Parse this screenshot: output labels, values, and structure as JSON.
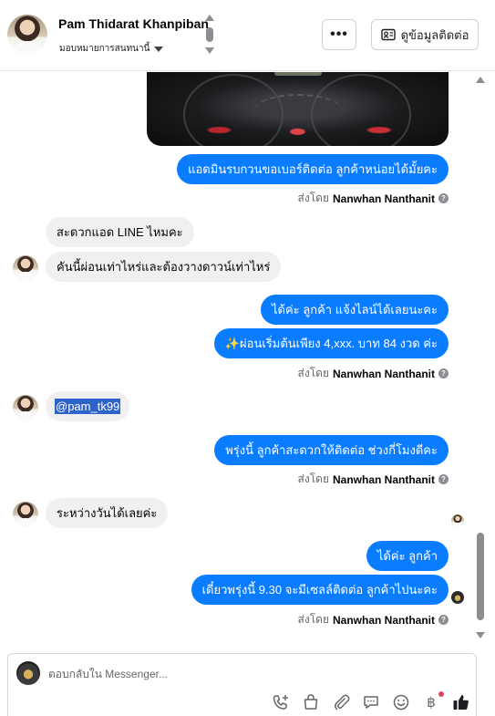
{
  "header": {
    "contact_name": "Pam Thidarat Khanpiban",
    "assign_label": "มอบหมายการสนทนานี้",
    "more_label": "•••",
    "contact_info_label": "ดูข้อมูลติดต่อ"
  },
  "messages": [
    {
      "from": "page",
      "text": "แอดมินรบกวนขอเบอร์ติดต่อ ลูกค้าหน่อยได้มั้ยคะ"
    },
    {
      "from": "customer",
      "text": "สะดวกแอด LINE ไหมคะ"
    },
    {
      "from": "customer",
      "text": "คันนี้ผ่อนเท่าไหร่และต้องวางดาวน์เท่าไหร่"
    },
    {
      "from": "page",
      "text": "ได้ค่ะ  ลูกค้า แจ้งไลน์ได้เลยนะคะ"
    },
    {
      "from": "page",
      "text": "✨ผ่อนเริ่มต้นเพียง 4,xxx. บาท 84 งวด ค่ะ"
    },
    {
      "from": "customer",
      "text": "@pam_tk99"
    },
    {
      "from": "page",
      "text": "พรุ่งนี้ ลูกค้าสะดวกให้ติดต่อ ช่วงกี่โมงดีคะ"
    },
    {
      "from": "customer",
      "text": "ระหว่างวันได้เลยค่ะ"
    },
    {
      "from": "page",
      "text": "ได้ค่ะ  ลูกค้า"
    },
    {
      "from": "page",
      "text": "เดี๋ยวพรุ่งนี้ 9.30 จะมีเซลล์ติดต่อ ลูกค้าไปนะคะ"
    }
  ],
  "sent_by": {
    "prefix": "ส่งโดย",
    "agent": "Nanwhan Nanthanit"
  },
  "composer": {
    "placeholder": "ตอบกลับใน Messenger...",
    "value": "",
    "currency_symbol": "฿"
  },
  "icons": {
    "more": "more-dots-icon",
    "contact": "contact-card-icon",
    "call": "phone-add-icon",
    "shop": "shopping-bag-icon",
    "attach": "paperclip-icon",
    "saved_reply": "chat-bubble-icon",
    "emoji": "smile-icon",
    "payment": "baht-icon",
    "like": "thumbs-up-icon"
  },
  "colors": {
    "outgoing_bubble": "#0a7cff",
    "incoming_bubble": "#f0f0f0",
    "like": "#1c1e21",
    "notification_dot": "#e4405f"
  }
}
